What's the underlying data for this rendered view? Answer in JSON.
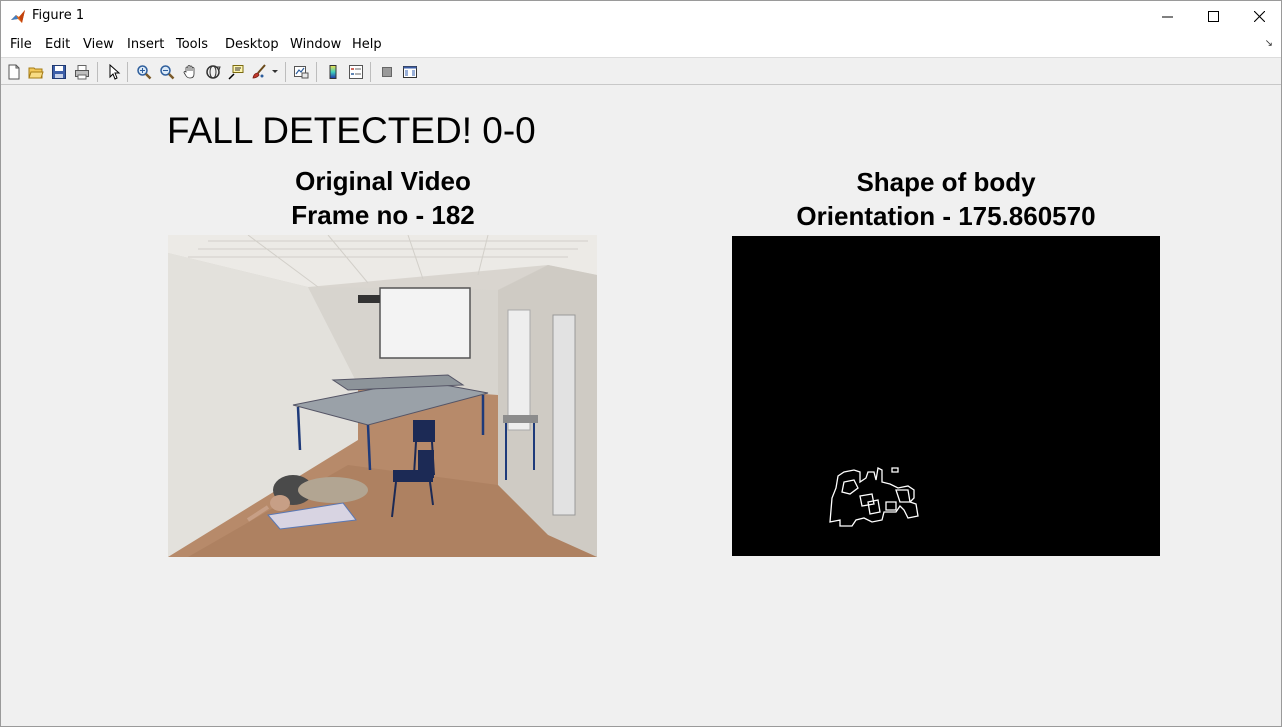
{
  "window": {
    "title": "Figure 1",
    "controls": {
      "minimize": "—",
      "maximize": "☐",
      "close": "✕"
    }
  },
  "menubar": {
    "items": [
      "File",
      "Edit",
      "View",
      "Insert",
      "Tools",
      "Desktop",
      "Window",
      "Help"
    ],
    "overflow": "↘"
  },
  "toolbar": {
    "buttons": [
      "new-figure",
      "open-file",
      "save-figure",
      "print-figure",
      "edit-plot",
      "zoom-in",
      "zoom-out",
      "pan",
      "rotate-3d",
      "data-cursor",
      "brush",
      "link-plot",
      "insert-colorbar",
      "insert-legend",
      "hide-plot-tools",
      "show-plot-tools"
    ]
  },
  "figure": {
    "status_text": "FALL DETECTED! 0-0",
    "left_axis": {
      "title_line1": "Original Video",
      "title_line2": "Frame no - 182"
    },
    "right_axis": {
      "title_line1": "Shape of body",
      "title_line2": "Orientation - 175.860570"
    }
  },
  "colors": {
    "background": "#f0f0f0",
    "shape_background": "#000000",
    "contour": "#ffffff"
  }
}
